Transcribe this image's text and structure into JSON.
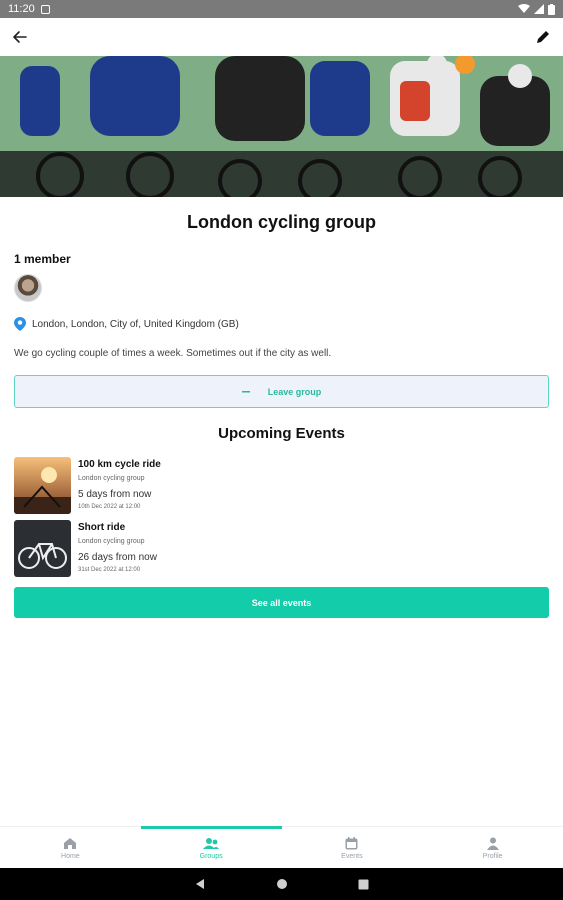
{
  "status_bar": {
    "time": "11:20"
  },
  "group": {
    "title": "London cycling group",
    "members_label": "1 member",
    "location": "London, London, City of, United Kingdom (GB)",
    "description": "We go cycling couple of times a week. Sometimes out if the city as well.",
    "leave_label": "Leave group"
  },
  "events": {
    "section_title": "Upcoming Events",
    "items": [
      {
        "name": "100 km cycle ride",
        "group": "London cycling group",
        "relative": "5 days from now",
        "date": "10th Dec 2022 at 12:00"
      },
      {
        "name": "Short ride",
        "group": "London cycling group",
        "relative": "26 days from now",
        "date": "31st Dec 2022 at 12:00"
      }
    ],
    "see_all_label": "See all events"
  },
  "nav": {
    "items": [
      {
        "label": "Home",
        "icon": "home-icon"
      },
      {
        "label": "Groups",
        "icon": "groups-icon"
      },
      {
        "label": "Events",
        "icon": "calendar-icon"
      },
      {
        "label": "Profile",
        "icon": "person-icon"
      }
    ],
    "active": "Groups"
  },
  "colors": {
    "accent": "#12ccaa",
    "leave_bg": "#eef2fb",
    "status_bar": "#7a7a7a"
  }
}
